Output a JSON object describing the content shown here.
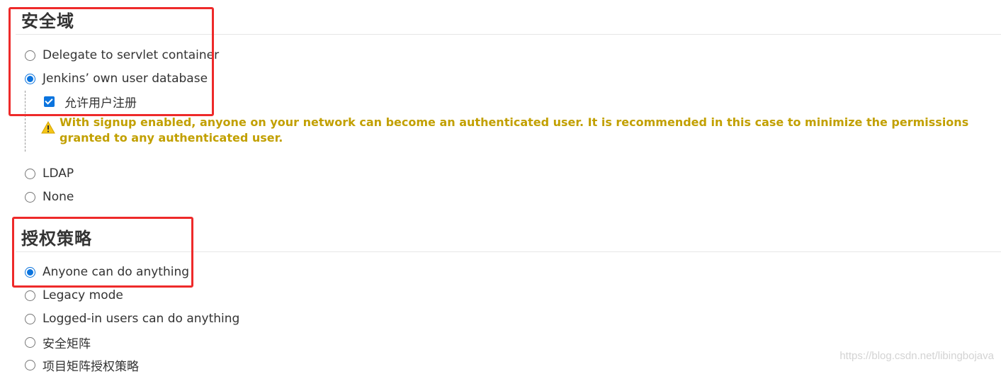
{
  "security_realm": {
    "title": "安全域",
    "options": [
      {
        "label": "Delegate to servlet container",
        "checked": false
      },
      {
        "label": "Jenkins’ own user database",
        "checked": true
      },
      {
        "label": "LDAP",
        "checked": false
      },
      {
        "label": "None",
        "checked": false
      }
    ],
    "allow_signup": {
      "label": "允许用户注册",
      "checked": true
    },
    "warning": "With signup enabled, anyone on your network can become an authenticated user. It is recommended in this case to minimize the permissions granted to any authenticated user."
  },
  "authorization": {
    "title": "授权策略",
    "options": [
      {
        "label": "Anyone can do anything",
        "checked": true
      },
      {
        "label": "Legacy mode",
        "checked": false
      },
      {
        "label": "Logged-in users can do anything",
        "checked": false
      },
      {
        "label": "安全矩阵",
        "checked": false
      },
      {
        "label": "项目矩阵授权策略",
        "checked": false
      }
    ]
  },
  "colors": {
    "accent": "#0b74de",
    "warning": "#c2a000",
    "highlight_box": "#ee2a2a"
  },
  "watermark": "https://blog.csdn.net/libingbojava"
}
